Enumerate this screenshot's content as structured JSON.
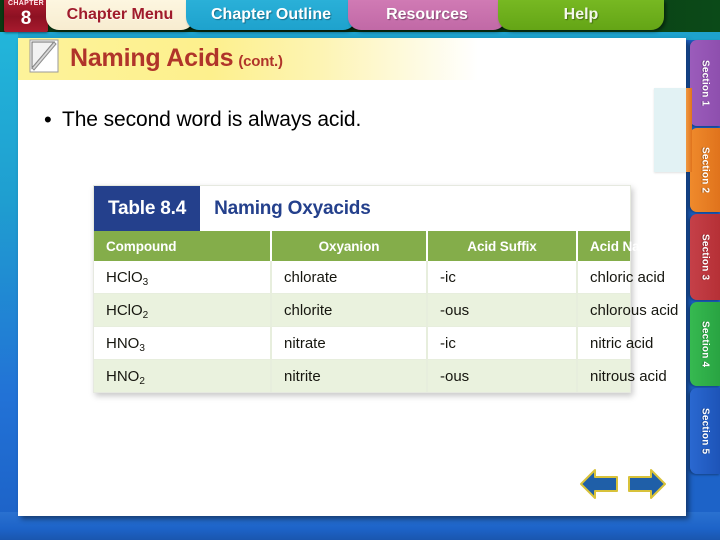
{
  "top_nav": {
    "chapter_badge": {
      "word": "CHAPTER",
      "number": "8"
    },
    "tabs": [
      {
        "id": "chapter-menu",
        "label": "Chapter Menu",
        "color": "#fdf6e0",
        "text_color": "#a01b2c"
      },
      {
        "id": "chapter-outline",
        "label": "Chapter Outline",
        "color": "#1ea2cd",
        "text_color": "#ffffff"
      },
      {
        "id": "resources",
        "label": "Resources",
        "color": "#c169a6",
        "text_color": "#ffffff"
      },
      {
        "id": "help",
        "label": "Help",
        "color": "#64a516",
        "text_color": "#f3f7ea"
      }
    ]
  },
  "slide": {
    "title": "Naming Acids",
    "title_suffix": "(cont.)",
    "title_color": "#b0342a",
    "title_band_color": "#fdf08d",
    "bullet_marker": "•",
    "bullet_text": "The second word is always acid."
  },
  "table": {
    "tag": "Table 8.4",
    "tag_bg": "#24408c",
    "title": "Naming Oxyacids",
    "title_color": "#24408c",
    "header_bg": "#84ad4a",
    "row_alt_bg": "#eaf2de",
    "columns": [
      "Compound",
      "Oxyanion",
      "Acid Suffix",
      "Acid Name"
    ],
    "rows": [
      {
        "compound": "HClO",
        "subscript": "3",
        "oxyanion": "chlorate",
        "suffix": "-ic",
        "acid_name": "chloric acid"
      },
      {
        "compound": "HClO",
        "subscript": "2",
        "oxyanion": "chlorite",
        "suffix": "-ous",
        "acid_name": "chlorous acid"
      },
      {
        "compound": "HNO",
        "subscript": "3",
        "oxyanion": "nitrate",
        "suffix": "-ic",
        "acid_name": "nitric acid"
      },
      {
        "compound": "HNO",
        "subscript": "2",
        "oxyanion": "nitrite",
        "suffix": "-ous",
        "acid_name": "nitrous acid"
      }
    ]
  },
  "section_rail": {
    "sections": [
      {
        "label": "Section 1",
        "color": "#9b5cbb",
        "active": false
      },
      {
        "label": "Section 2",
        "color": "#ef8a2c",
        "active": true
      },
      {
        "label": "Section 3",
        "color": "#c54048",
        "active": false
      },
      {
        "label": "Section 4",
        "color": "#36b950",
        "active": false
      },
      {
        "label": "Section 5",
        "color": "#2a68d0",
        "active": false
      }
    ]
  },
  "navigation": {
    "previous_label": "Previous slide",
    "next_label": "Next slide",
    "arrow_fill": "#1f5fa8",
    "arrow_border": "#d8c23a"
  }
}
